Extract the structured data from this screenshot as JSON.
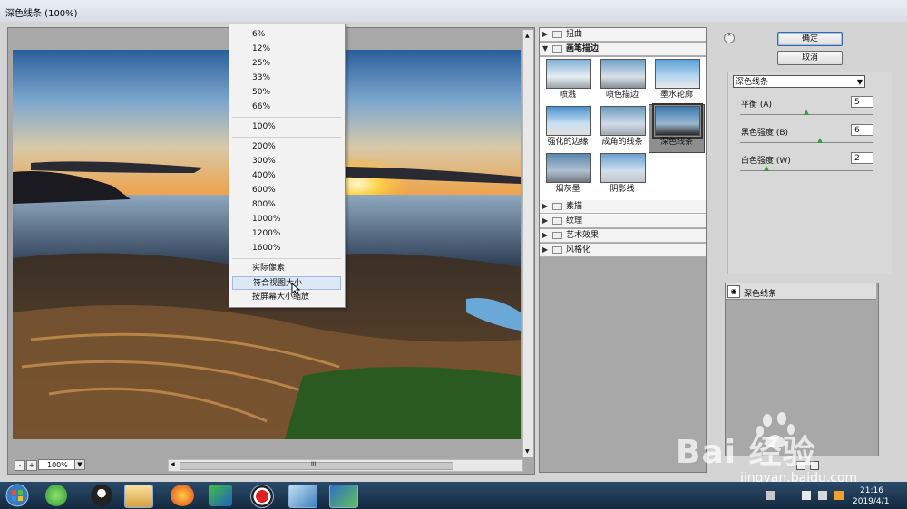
{
  "window": {
    "title": "深色线条 (100%)"
  },
  "zoom_menu": {
    "items": [
      "6%",
      "12%",
      "25%",
      "33%",
      "50%",
      "66%",
      "100%",
      "200%",
      "300%",
      "400%",
      "600%",
      "800%",
      "1000%",
      "1200%",
      "1600%",
      "实际像素",
      "符合视图大小",
      "按屏幕大小缩放"
    ],
    "highlighted": "符合视图大小"
  },
  "zoom_control": {
    "minus": "-",
    "plus": "+",
    "value": "100%"
  },
  "scroll_grip": "III",
  "gallery": {
    "categories_top": [
      {
        "label": "扭曲",
        "expanded": false
      },
      {
        "label": "画笔描边",
        "expanded": true
      }
    ],
    "filters": [
      "喷溅",
      "喷色描边",
      "墨水轮廓",
      "强化的边缘",
      "成角的线条",
      "深色线条",
      "烟灰墨",
      "阴影线"
    ],
    "selected_filter": "深色线条",
    "categories_bottom": [
      "素描",
      "纹理",
      "艺术效果",
      "风格化"
    ]
  },
  "buttons": {
    "ok": "确定",
    "cancel": "取消"
  },
  "settings": {
    "filter_select": "深色线条",
    "params": [
      {
        "label": "平衡 (A)",
        "value": "5",
        "fraction": 0.5
      },
      {
        "label": "黑色强度 (B)",
        "value": "6",
        "fraction": 0.6
      },
      {
        "label": "白色强度 (W)",
        "value": "2",
        "fraction": 0.2
      }
    ]
  },
  "layers": {
    "name": "深色线条"
  },
  "watermark": {
    "text": "Bai 经验",
    "url": "jingyan.baidu.com"
  },
  "taskbar": {
    "time": "21:16",
    "date": "2019/4/1"
  },
  "colors": {
    "selection": "#8e8e8e",
    "slider_knob": "#3a9a3a",
    "taskbar": "#1c3550"
  }
}
